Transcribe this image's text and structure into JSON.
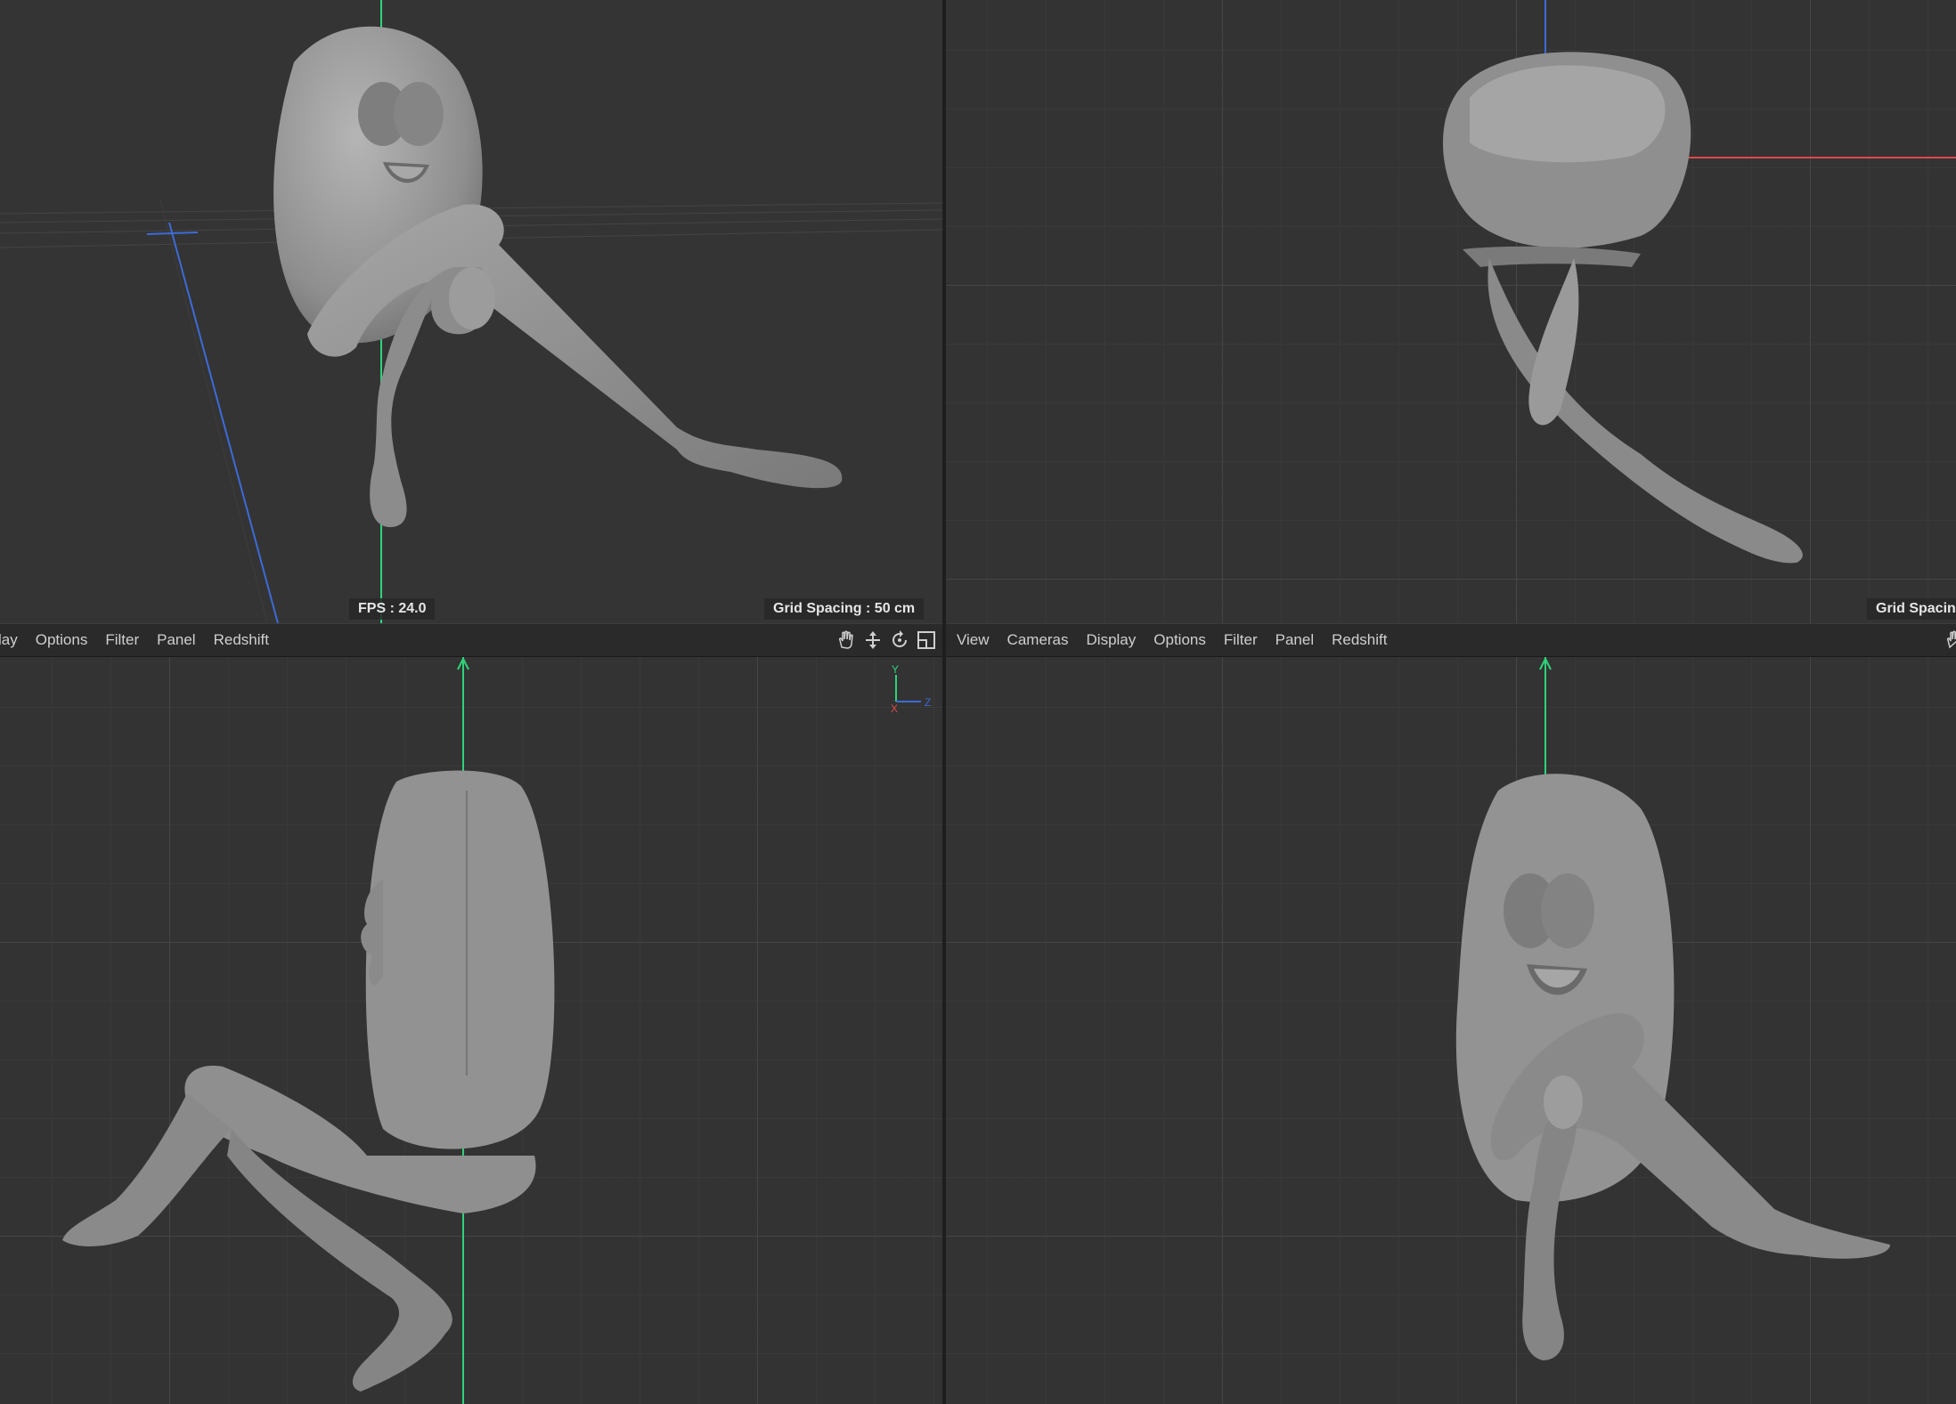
{
  "viewports": {
    "top_left": {
      "fps_label": "FPS : 24.0",
      "grid_label": "Grid Spacing : 50 cm"
    },
    "top_right": {
      "grid_label": "Grid Spacin"
    }
  },
  "menubar_left": {
    "items": [
      "lay",
      "Options",
      "Filter",
      "Panel",
      "Redshift"
    ]
  },
  "menubar_right": {
    "items": [
      "View",
      "Cameras",
      "Display",
      "Options",
      "Filter",
      "Panel",
      "Redshift"
    ]
  },
  "axis_gizmo": {
    "y": "Y",
    "x": "X",
    "z": "Z"
  },
  "icons": [
    "pan-hand-icon",
    "move-arrows-icon",
    "rotate-icon",
    "maximize-icon"
  ],
  "colors": {
    "viewport_bg": "#333333",
    "axis_green": "#2fd27a",
    "axis_blue": "#3c6bd8",
    "axis_red": "#e0484a",
    "model": "#9b9b9b"
  }
}
